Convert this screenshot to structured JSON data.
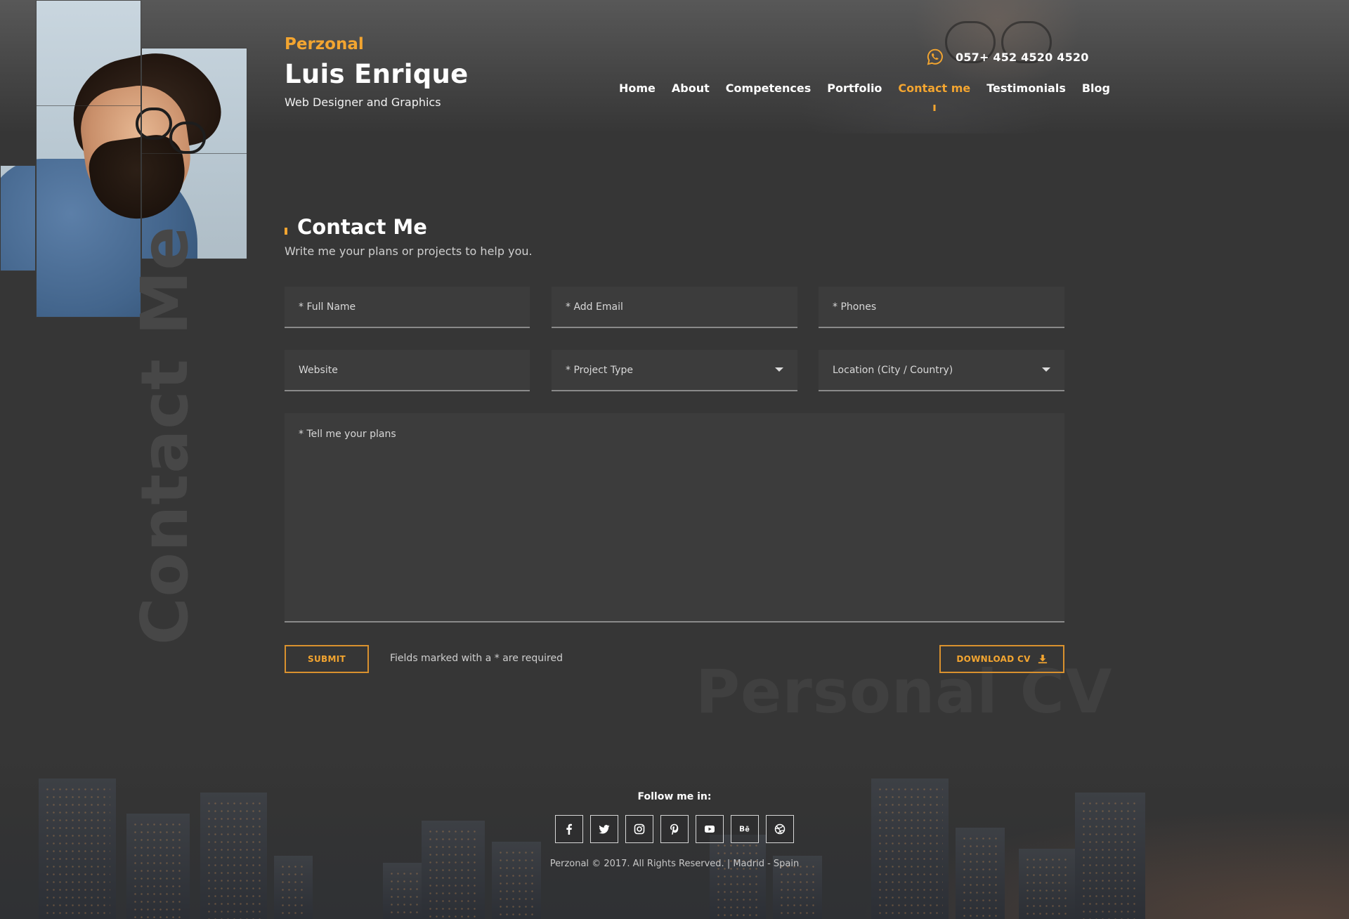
{
  "brand": {
    "small": "Perzonal",
    "name": "Luis Enrique",
    "subtitle": "Web Designer and Graphics"
  },
  "phone": {
    "icon": "whatsapp-icon",
    "number": "057+ 452 4520 4520"
  },
  "nav": {
    "items": [
      {
        "label": "Home"
      },
      {
        "label": "About"
      },
      {
        "label": "Competences"
      },
      {
        "label": "Portfolio"
      },
      {
        "label": "Contact me",
        "active": true
      },
      {
        "label": "Testimonials"
      },
      {
        "label": "Blog"
      }
    ]
  },
  "section": {
    "title": "Contact Me",
    "subtitle": "Write me your plans or projects to help you.",
    "vertical_watermark": "Contact Me"
  },
  "form": {
    "full_name": "* Full Name",
    "email": "* Add Email",
    "phones": "* Phones",
    "website": "Website",
    "project_type": "* Project Type",
    "location": "Location (City / Country)",
    "plans": "* Tell me your plans",
    "submit_label": "SUBMIT",
    "required_note": "Fields marked with a * are required",
    "download_label": "DOWNLOAD CV"
  },
  "watermark": "Personal CV",
  "footer": {
    "follow": "Follow me in:",
    "socials": [
      "facebook-icon",
      "twitter-icon",
      "instagram-icon",
      "pinterest-icon",
      "youtube-icon",
      "behance-icon",
      "dribbble-icon"
    ],
    "copyright": "Perzonal © 2017. All Rights Reserved.  |  Madrid - Spain"
  },
  "colors": {
    "accent": "#f3a530",
    "background": "#363636",
    "field": "#3c3c3c"
  }
}
